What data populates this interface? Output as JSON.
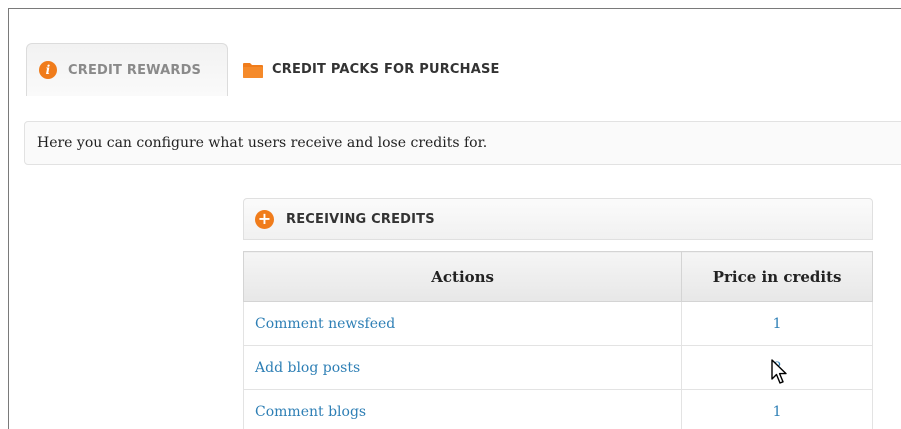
{
  "tabs": [
    {
      "label": "CREDIT REWARDS",
      "icon": "info-icon",
      "active": true
    },
    {
      "label": "CREDIT PACKS FOR PURCHASE",
      "icon": "folder-icon",
      "active": false
    }
  ],
  "description": "Here you can configure what users receive and lose credits for.",
  "section": {
    "title": "RECEIVING CREDITS",
    "icon": "plus-circle-icon"
  },
  "table": {
    "headers": [
      "Actions",
      "Price in credits"
    ],
    "rows": [
      {
        "action": "Comment newsfeed",
        "price": "1"
      },
      {
        "action": "Add blog posts",
        "price": "8"
      },
      {
        "action": "Comment blogs",
        "price": "1"
      }
    ]
  },
  "colors": {
    "accent": "#f07c1b",
    "link": "#2e7fb5"
  }
}
